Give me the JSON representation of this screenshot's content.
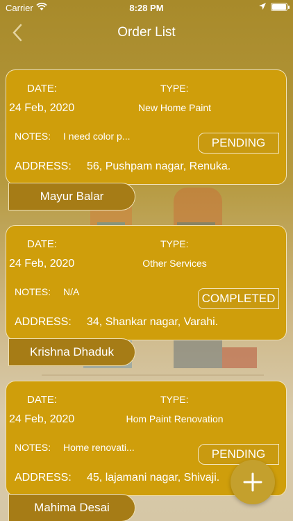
{
  "status_bar": {
    "carrier": "Carrier",
    "time": "8:28 PM"
  },
  "nav": {
    "title": "Order List"
  },
  "labels": {
    "date": "DATE:",
    "type": "TYPE:",
    "notes": "NOTES:",
    "address": "ADDRESS:"
  },
  "orders": [
    {
      "date": "24 Feb, 2020",
      "type": "New Home Paint",
      "notes": "I need color p...",
      "status": "PENDING",
      "address": "56, Pushpam nagar, Renuka.",
      "name": "Mayur Balar"
    },
    {
      "date": "24 Feb, 2020",
      "type": "Other Services",
      "notes": "N/A",
      "status": "COMPLETED",
      "address": "34, Shankar nagar, Varahi.",
      "name": "Krishna Dhaduk"
    },
    {
      "date": "24 Feb, 2020",
      "type": "Hom Paint Renovation",
      "notes": "Home renovati...",
      "status": "PENDING",
      "address": "45, lajamani nagar, Shivaji.",
      "name": "Mahima Desai"
    }
  ],
  "icons": {
    "back": "chevron-left-icon",
    "add": "plus-icon",
    "wifi": "wifi-icon",
    "location": "location-arrow-icon",
    "battery": "battery-icon"
  },
  "colors": {
    "card": "#cf9e0b",
    "name_tag": "#a67c16",
    "fab": "#c4a02d",
    "text": "#ffffff"
  }
}
